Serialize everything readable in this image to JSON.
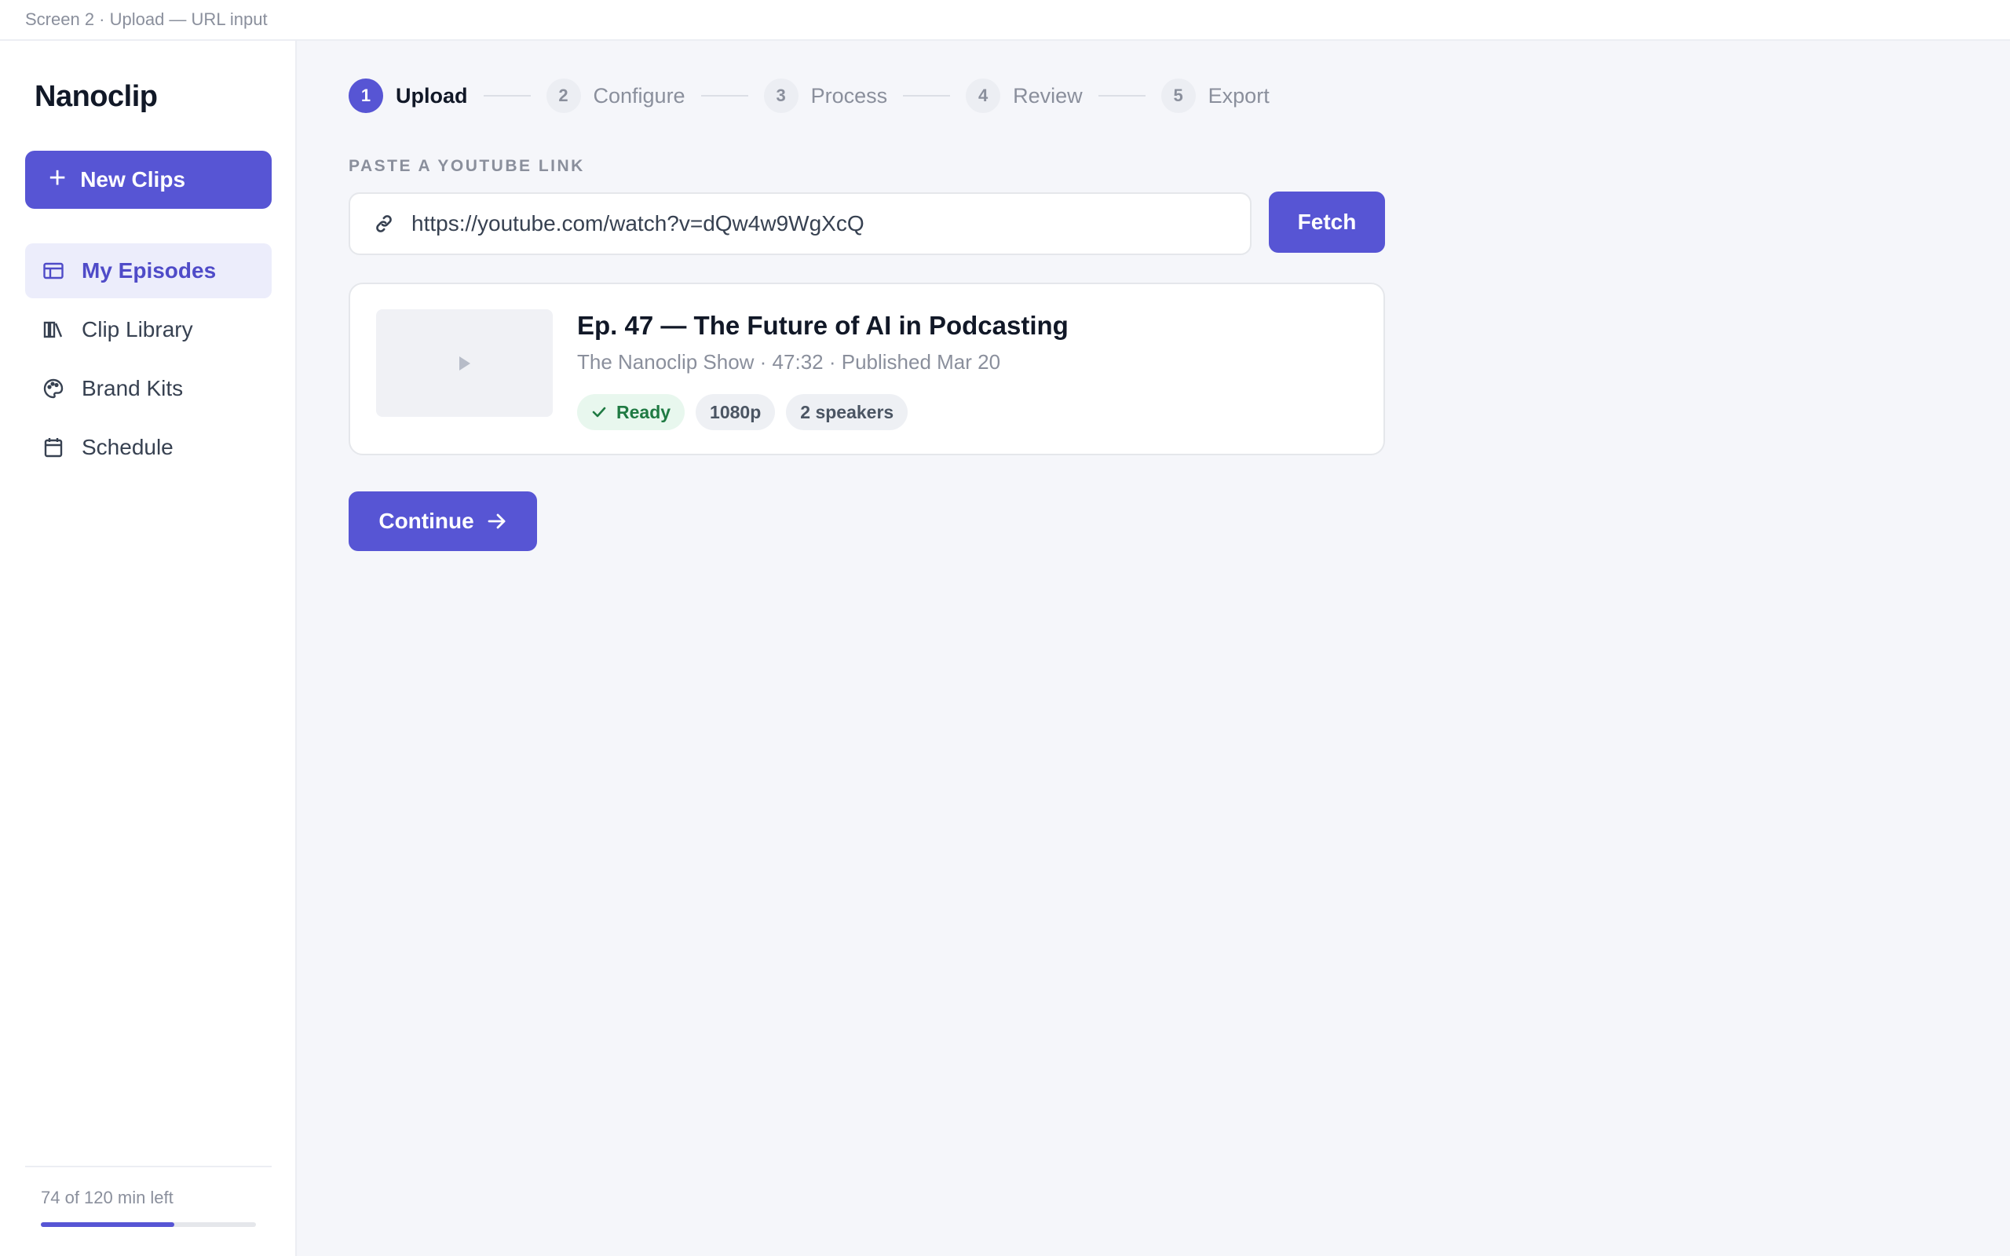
{
  "screen_label": "Screen 2 · Upload — URL input",
  "app": {
    "name": "Nanoclip"
  },
  "sidebar": {
    "new_button": "New Clips",
    "items": [
      {
        "label": "My Episodes",
        "icon": "table-icon",
        "active": true
      },
      {
        "label": "Clip Library",
        "icon": "library-icon",
        "active": false
      },
      {
        "label": "Brand Kits",
        "icon": "palette-icon",
        "active": false
      },
      {
        "label": "Schedule",
        "icon": "calendar-icon",
        "active": false
      }
    ],
    "quota": {
      "text": "74 of 120 min left",
      "used_fraction": 0.62
    }
  },
  "stepper": {
    "steps": [
      {
        "num": "1",
        "label": "Upload",
        "active": true
      },
      {
        "num": "2",
        "label": "Configure",
        "active": false
      },
      {
        "num": "3",
        "label": "Process",
        "active": false
      },
      {
        "num": "4",
        "label": "Review",
        "active": false
      },
      {
        "num": "5",
        "label": "Export",
        "active": false
      }
    ]
  },
  "url_field": {
    "label": "PASTE A YOUTUBE LINK",
    "value": "https://youtube.com/watch?v=dQw4w9WgXcQ",
    "icon": "link-icon"
  },
  "fetch_button": "Fetch",
  "episode": {
    "title": "Ep. 47 — The Future of AI in Podcasting",
    "meta": "The Nanoclip Show · 47:32 · Published Mar 20",
    "chips": [
      "Ready",
      "1080p",
      "2 speakers"
    ]
  },
  "continue_button": "Continue",
  "colors": {
    "accent": "#5755d4",
    "ready_green": "#1f7a43",
    "background": "#f5f6fa"
  }
}
